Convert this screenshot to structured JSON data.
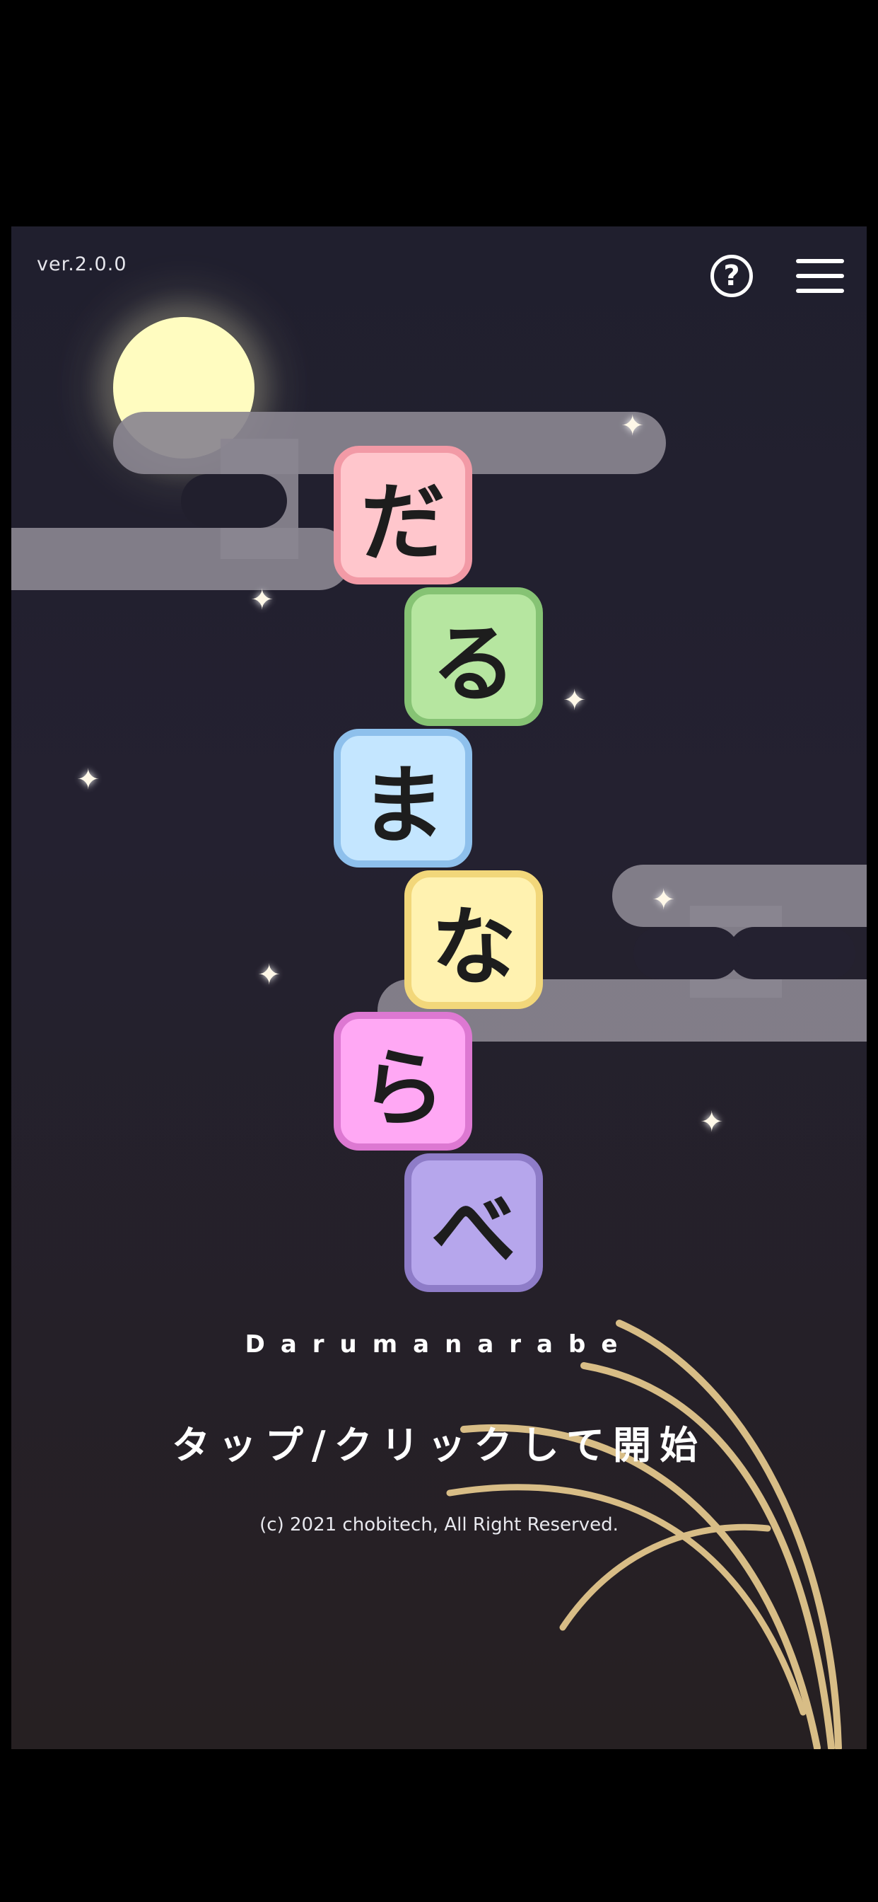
{
  "version": "ver.2.0.0",
  "title_tiles": [
    {
      "char": "だ",
      "bg": "#ffc6cc",
      "border": "#f29aa6"
    },
    {
      "char": "る",
      "bg": "#b6e6a0",
      "border": "#86c374"
    },
    {
      "char": "ま",
      "bg": "#c4e6ff",
      "border": "#8ec0ec"
    },
    {
      "char": "な",
      "bg": "#fff2b0",
      "border": "#f2d77a"
    },
    {
      "char": "ら",
      "bg": "#ffa8f4",
      "border": "#dd78d2"
    },
    {
      "char": "べ",
      "bg": "#b6a6ec",
      "border": "#8e7cc8"
    }
  ],
  "subtitle": "Darumanarabe",
  "start_prompt": "タップ/クリックして開始",
  "copyright": "(c) 2021 chobitech, All Right Reserved.",
  "icons": {
    "help": "help-circle-icon",
    "menu": "hamburger-menu-icon",
    "help_glyph": "?"
  },
  "colors": {
    "background_top": "#201f2e",
    "background_bottom": "#262022",
    "moon": "#fffcc0",
    "cloud": "#8a8690",
    "grass": "#d8bd86"
  }
}
